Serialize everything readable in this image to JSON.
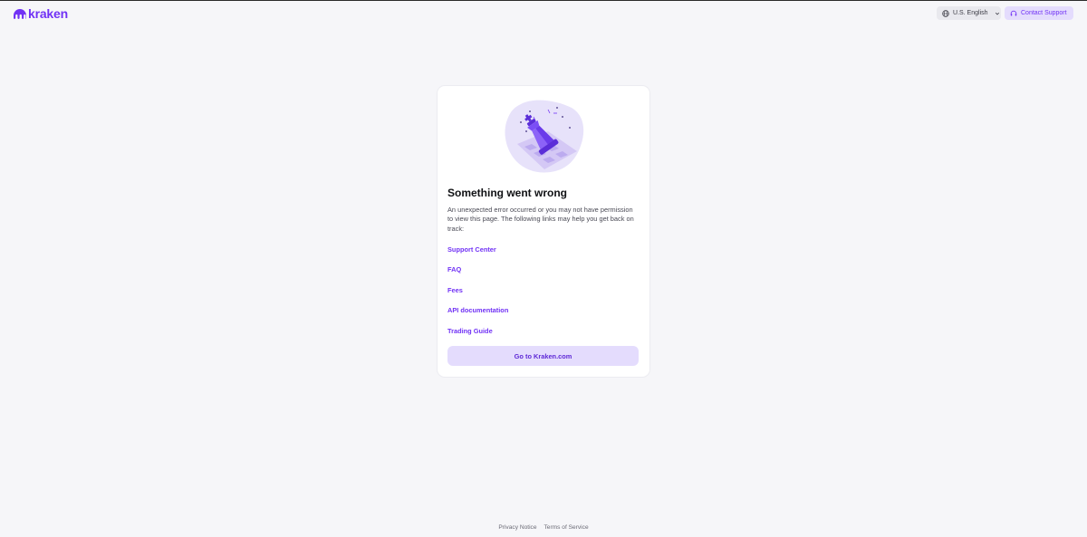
{
  "header": {
    "logo_text": "kraken",
    "language_label": "U.S. English",
    "contact_support_label": "Contact Support"
  },
  "card": {
    "title": "Something went wrong",
    "description": "An unexpected error occurred or you may not have permission to view this page. The following links may help you get back on track:",
    "links": [
      {
        "label": "Support Center"
      },
      {
        "label": "FAQ"
      },
      {
        "label": "Fees"
      },
      {
        "label": "API documentation"
      },
      {
        "label": "Trading Guide"
      }
    ],
    "cta_label": "Go to Kraken.com"
  },
  "footer": {
    "privacy_label": "Privacy Notice",
    "terms_label": "Terms of Service"
  },
  "colors": {
    "brand": "#7132f5",
    "background": "#f6f6f9",
    "cta_bg": "#e4dcfd"
  },
  "icons": [
    "kraken-logo-icon",
    "globe-icon",
    "chevron-down-icon",
    "headset-icon",
    "chess-king-illustration"
  ]
}
